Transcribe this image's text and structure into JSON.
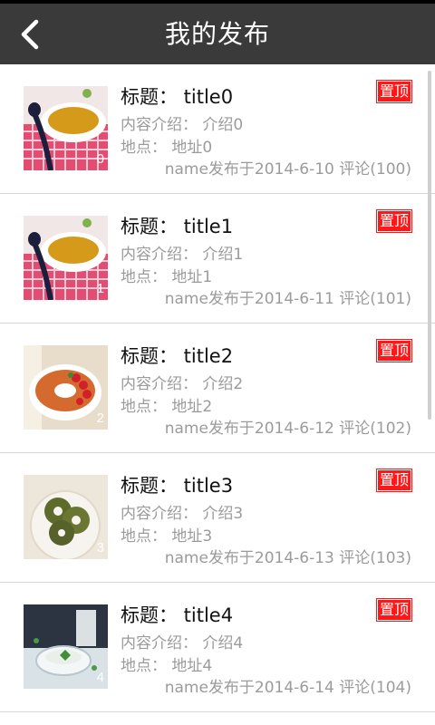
{
  "header": {
    "title": "我的发布"
  },
  "items": [
    {
      "title": "标题： title0",
      "intro": "内容介绍： 介绍0",
      "location": "地点： 地址0",
      "meta": "name发布于2014-6-10 评论(100)",
      "badge": "置顶",
      "index": "0"
    },
    {
      "title": "标题： title1",
      "intro": "内容介绍： 介绍1",
      "location": "地点： 地址1",
      "meta": "name发布于2014-6-11 评论(101)",
      "badge": "置顶",
      "index": "1"
    },
    {
      "title": "标题： title2",
      "intro": "内容介绍： 介绍2",
      "location": "地点： 地址2",
      "meta": "name发布于2014-6-12 评论(102)",
      "badge": "置顶",
      "index": "2"
    },
    {
      "title": "标题： title3",
      "intro": "内容介绍： 介绍3",
      "location": "地点： 地址3",
      "meta": "name发布于2014-6-13 评论(103)",
      "badge": "置顶",
      "index": "3"
    },
    {
      "title": "标题： title4",
      "intro": "内容介绍： 介绍4",
      "location": "地点： 地址4",
      "meta": "name发布于2014-6-14 评论(104)",
      "badge": "置顶",
      "index": "4"
    }
  ],
  "colors": {
    "header_bg": "#3a3a3a",
    "badge_red": "#ff1616",
    "text_secondary": "#9b9b9b"
  }
}
